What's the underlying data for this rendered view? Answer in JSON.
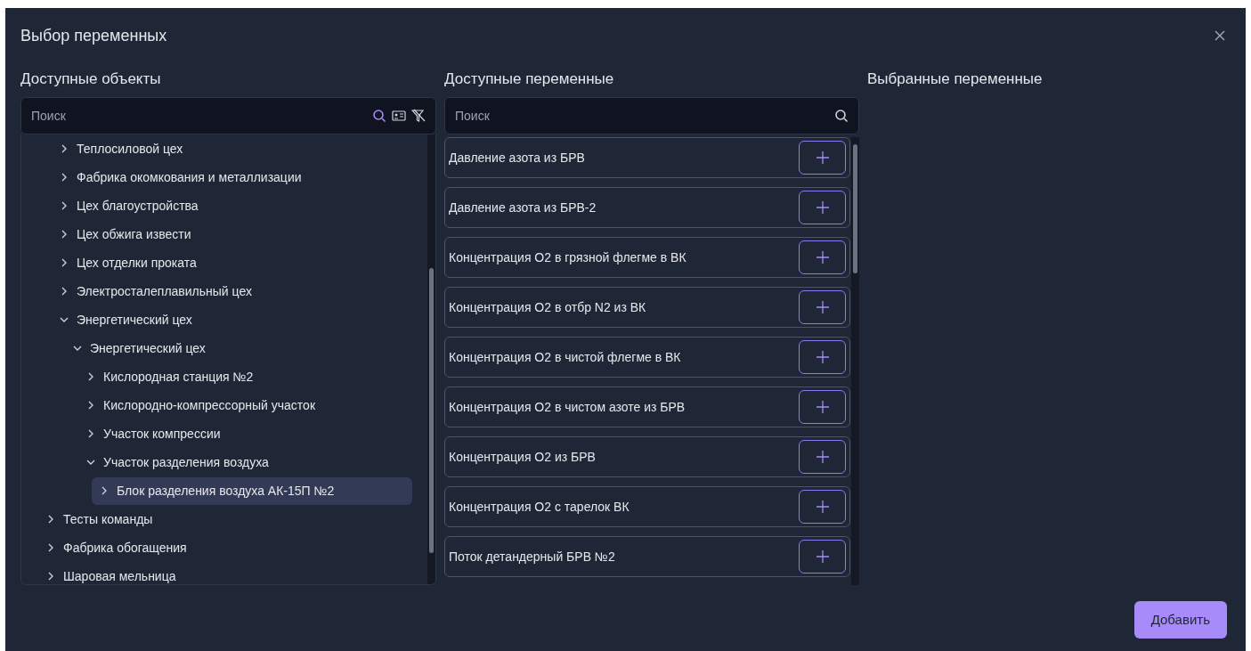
{
  "dialog": {
    "title": "Выбор переменных"
  },
  "objects": {
    "heading": "Доступные объекты",
    "search": {
      "placeholder": "Поиск"
    },
    "tree": [
      {
        "children": [
          {
            "label": "Теплосиловой цех",
            "expanded": false,
            "selected": false
          },
          {
            "label": "Фабрика окомкования и металлизации",
            "expanded": false,
            "selected": false
          },
          {
            "label": "Цех благоустройства",
            "expanded": false,
            "selected": false
          },
          {
            "label": "Цех обжига извести",
            "expanded": false,
            "selected": false
          },
          {
            "label": "Цех отделки проката",
            "expanded": false,
            "selected": false
          },
          {
            "label": "Электросталеплавильный цех",
            "expanded": false,
            "selected": false
          },
          {
            "label": "Энергетический цех",
            "expanded": true,
            "selected": false,
            "children": [
              {
                "label": "Энергетический цех",
                "expanded": true,
                "selected": false,
                "children": [
                  {
                    "label": "Кислородная станция №2",
                    "expanded": false,
                    "selected": false
                  },
                  {
                    "label": "Кислородно-компрессорный участок",
                    "expanded": false,
                    "selected": false
                  },
                  {
                    "label": "Участок компрессии",
                    "expanded": false,
                    "selected": false
                  },
                  {
                    "label": "Участок разделения воздуха",
                    "expanded": true,
                    "selected": false,
                    "children": [
                      {
                        "label": "Блок разделения воздуха АК-15П №2",
                        "expanded": false,
                        "selected": true
                      }
                    ]
                  }
                ]
              }
            ]
          }
        ]
      },
      {
        "label": "Тесты команды",
        "expanded": false,
        "selected": false
      },
      {
        "label": "Фабрика обогащения",
        "expanded": false,
        "selected": false
      },
      {
        "label": "Шаровая мельница",
        "expanded": false,
        "selected": false
      }
    ]
  },
  "variables": {
    "heading": "Доступные переменные",
    "search": {
      "placeholder": "Поиск"
    },
    "items": [
      {
        "label": "Давление азота из БРВ"
      },
      {
        "label": "Давление азота из БРВ-2"
      },
      {
        "label": "Концентрация О2 в грязной флегме в ВК"
      },
      {
        "label": "Концентрация О2 в отбр N2 из ВК"
      },
      {
        "label": "Концентрация О2 в чистой флегме в ВК"
      },
      {
        "label": "Концентрация О2 в чистом азоте из БРВ"
      },
      {
        "label": "Концентрация О2 из БРВ"
      },
      {
        "label": "Концентрация О2 с тарелок ВК"
      },
      {
        "label": "Поток детандерный БРВ №2"
      }
    ]
  },
  "selected": {
    "heading": "Выбранные переменные"
  },
  "buttons": [
    {
      "label": "Добавить"
    }
  ]
}
